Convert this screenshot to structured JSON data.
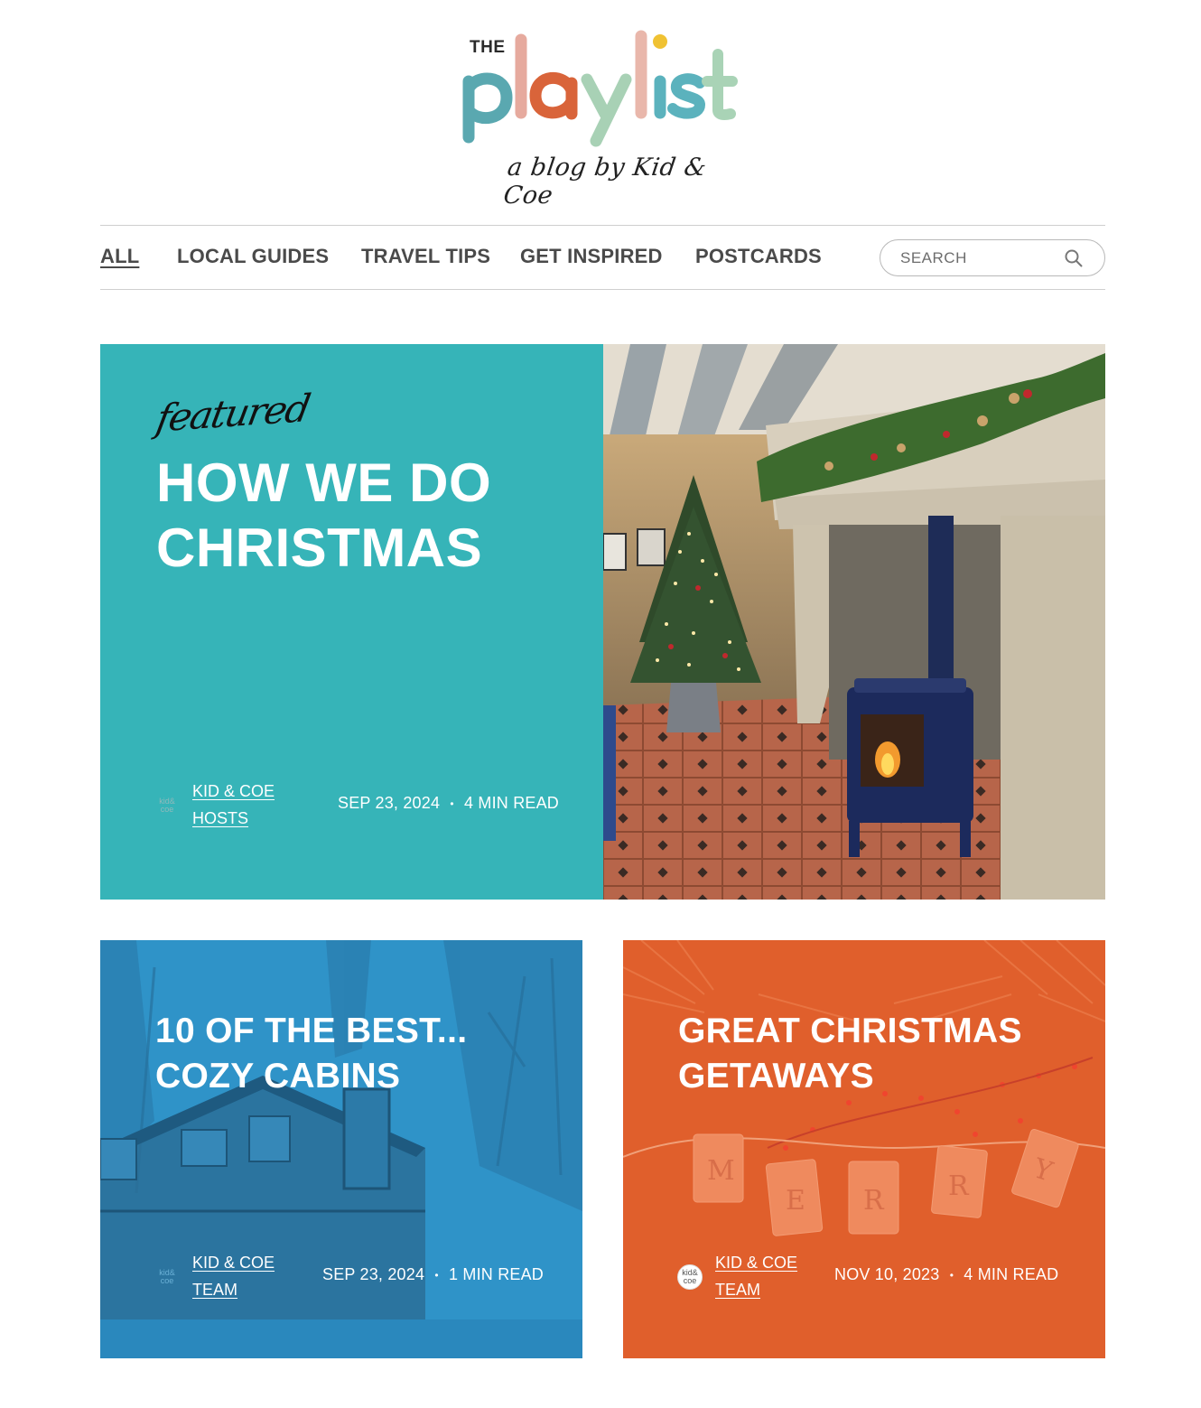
{
  "logo": {
    "the": "THE",
    "letters": [
      {
        "ch": "p",
        "color": "#5aa8b0"
      },
      {
        "ch": "l",
        "color": "#e0a79c"
      },
      {
        "ch": "a",
        "color": "#d9643a"
      },
      {
        "ch": "y",
        "color": "#a8d1b5"
      },
      {
        "ch": "l",
        "color": "#e9b7ab"
      },
      {
        "ch": "i",
        "color": "#5bb2bd"
      },
      {
        "ch": "s",
        "color": "#5bb2bd"
      },
      {
        "ch": "t",
        "color": "#a9d3b6"
      }
    ],
    "dot_color": "#f0c233",
    "tagline": "a blog by Kid & Coe"
  },
  "nav": {
    "items": [
      {
        "label": "ALL",
        "active": true
      },
      {
        "label": "LOCAL GUIDES",
        "active": false
      },
      {
        "label": "TRAVEL TIPS",
        "active": false
      },
      {
        "label": "GET INSPIRED",
        "active": false
      },
      {
        "label": "POSTCARDS",
        "active": false
      }
    ],
    "search_placeholder": "SEARCH",
    "search_icon": "search-icon"
  },
  "featured": {
    "badge": "featured",
    "title": "HOW WE DO CHRISTMAS",
    "author_line1": "KID & COE",
    "author_line2": "HOSTS",
    "date": "SEP 23, 2024",
    "read_time": "4 MIN READ",
    "panel_color": "#36b4b8",
    "image": "living-room-fireplace-christmas-tree"
  },
  "cards": [
    {
      "title": "10 OF THE BEST... COZY CABINS",
      "author_line1": "KID & COE",
      "author_line2": "TEAM",
      "date": "SEP 23, 2024",
      "read_time": "1 MIN READ",
      "overlay_color": "#2f93c8",
      "image": "wooden-cabin-in-woods"
    },
    {
      "title": "GREAT CHRISTMAS GETAWAYS",
      "author_line1": "KID & COE",
      "author_line2": "TEAM",
      "date": "NOV 10, 2023",
      "read_time": "4 MIN READ",
      "overlay_color": "#e05f2c",
      "image": "merry-garland-tags"
    }
  ],
  "separator": "•"
}
